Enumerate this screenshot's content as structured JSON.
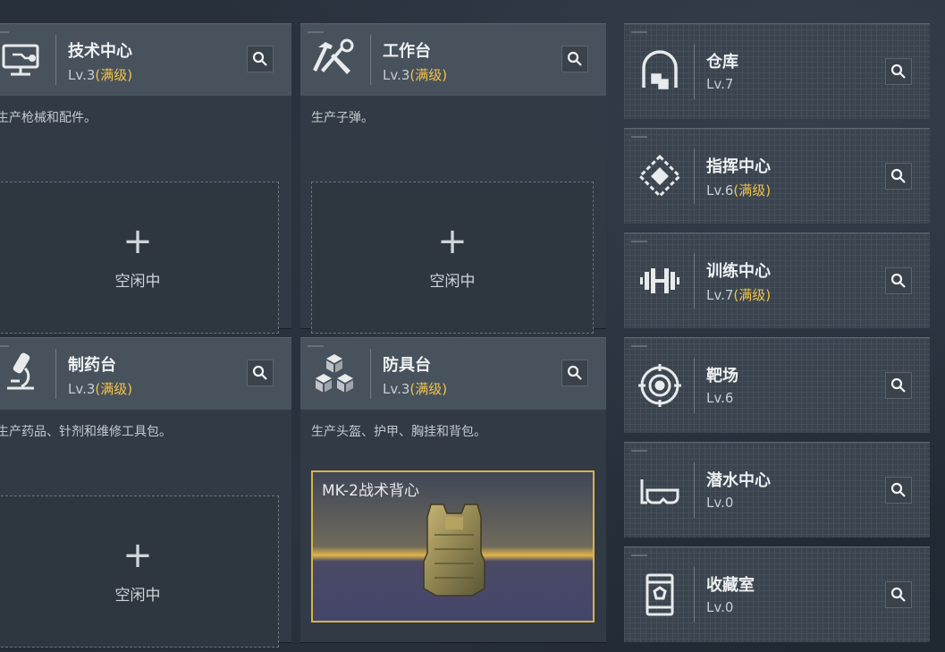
{
  "workshops": [
    {
      "name": "技术中心",
      "level": "Lv.3",
      "max": "(满级)",
      "desc": "生产枪械和配件。",
      "slot": {
        "plus": "+",
        "status": "空闲中"
      },
      "icon": "computer-icon"
    },
    {
      "name": "工作台",
      "level": "Lv.3",
      "max": "(满级)",
      "desc": "生产子弹。",
      "slot": {
        "plus": "+",
        "status": "空闲中"
      },
      "icon": "hammer-wrench-icon"
    },
    {
      "name": "制药台",
      "level": "Lv.3",
      "max": "(满级)",
      "desc": "生产药品、针剂和维修工具包。",
      "slot": {
        "plus": "+",
        "status": "空闲中"
      },
      "icon": "microscope-icon"
    },
    {
      "name": "防具台",
      "level": "Lv.3",
      "max": "(满级)",
      "desc": "生产头盔、护甲、胸挂和背包。",
      "product": {
        "name": "MK-2战术背心"
      },
      "icon": "cubes-icon"
    }
  ],
  "facilities": [
    {
      "name": "仓库",
      "level": "Lv.7",
      "max": "",
      "icon": "warehouse-icon"
    },
    {
      "name": "指挥中心",
      "level": "Lv.6",
      "max": "(满级)",
      "icon": "command-diamond-icon"
    },
    {
      "name": "训练中心",
      "level": "Lv.7",
      "max": "(满级)",
      "icon": "dumbbell-icon"
    },
    {
      "name": "靶场",
      "level": "Lv.6",
      "max": "",
      "icon": "target-icon"
    },
    {
      "name": "潜水中心",
      "level": "Lv.0",
      "max": "",
      "icon": "diving-mask-icon"
    },
    {
      "name": "收藏室",
      "level": "Lv.0",
      "max": "",
      "icon": "display-case-icon"
    }
  ],
  "colors": {
    "max_level": "#f0c24a",
    "product_border": "#d9b24a"
  }
}
